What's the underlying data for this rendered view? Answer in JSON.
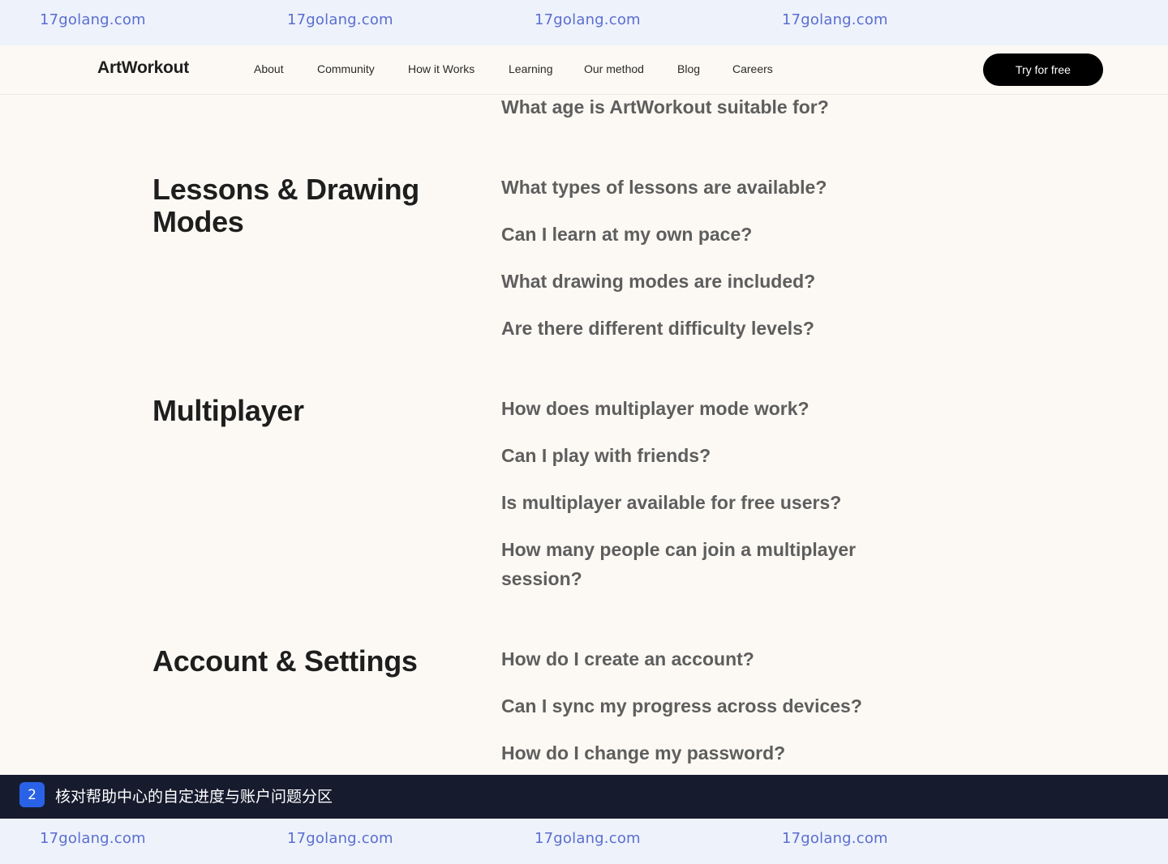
{
  "watermark": {
    "top": [
      "17golang.com",
      "17golang.com",
      "17golang.com",
      "17golang.com"
    ],
    "bottom": [
      "17golang.com",
      "17golang.com",
      "17golang.com",
      "17golang.com"
    ]
  },
  "nav": {
    "logo": "ArtWorkout",
    "links": [
      "About",
      "Community",
      "How it Works",
      "Learning",
      "Our method",
      "Blog",
      "Careers"
    ],
    "cta": "Try for free"
  },
  "faq": {
    "partial_question": "What age is ArtWorkout suitable for?",
    "sections": [
      {
        "title": "Lessons & Drawing Modes",
        "questions": [
          "What types of lessons are available?",
          "Can I learn at my own pace?",
          "What drawing modes are included?",
          "Are there different difficulty levels?"
        ]
      },
      {
        "title": "Multiplayer",
        "questions": [
          "How does multiplayer mode work?",
          "Can I play with friends?",
          "Is multiplayer available for free users?",
          "How many people can join a multiplayer session?"
        ]
      },
      {
        "title": "Account & Settings",
        "questions": [
          "How do I create an account?",
          "Can I sync my progress across devices?",
          "How do I change my password?"
        ]
      }
    ]
  },
  "caption": {
    "step": "2",
    "text": "核对帮助中心的自定进度与账户问题分区"
  },
  "colors": {
    "background": "#fcf9f4",
    "question_text": "#5e5e5e",
    "cta_background": "#000000",
    "caption_bar": "#161b2e",
    "step_badge": "#2962e6",
    "watermark_text": "#5a6ed0"
  }
}
